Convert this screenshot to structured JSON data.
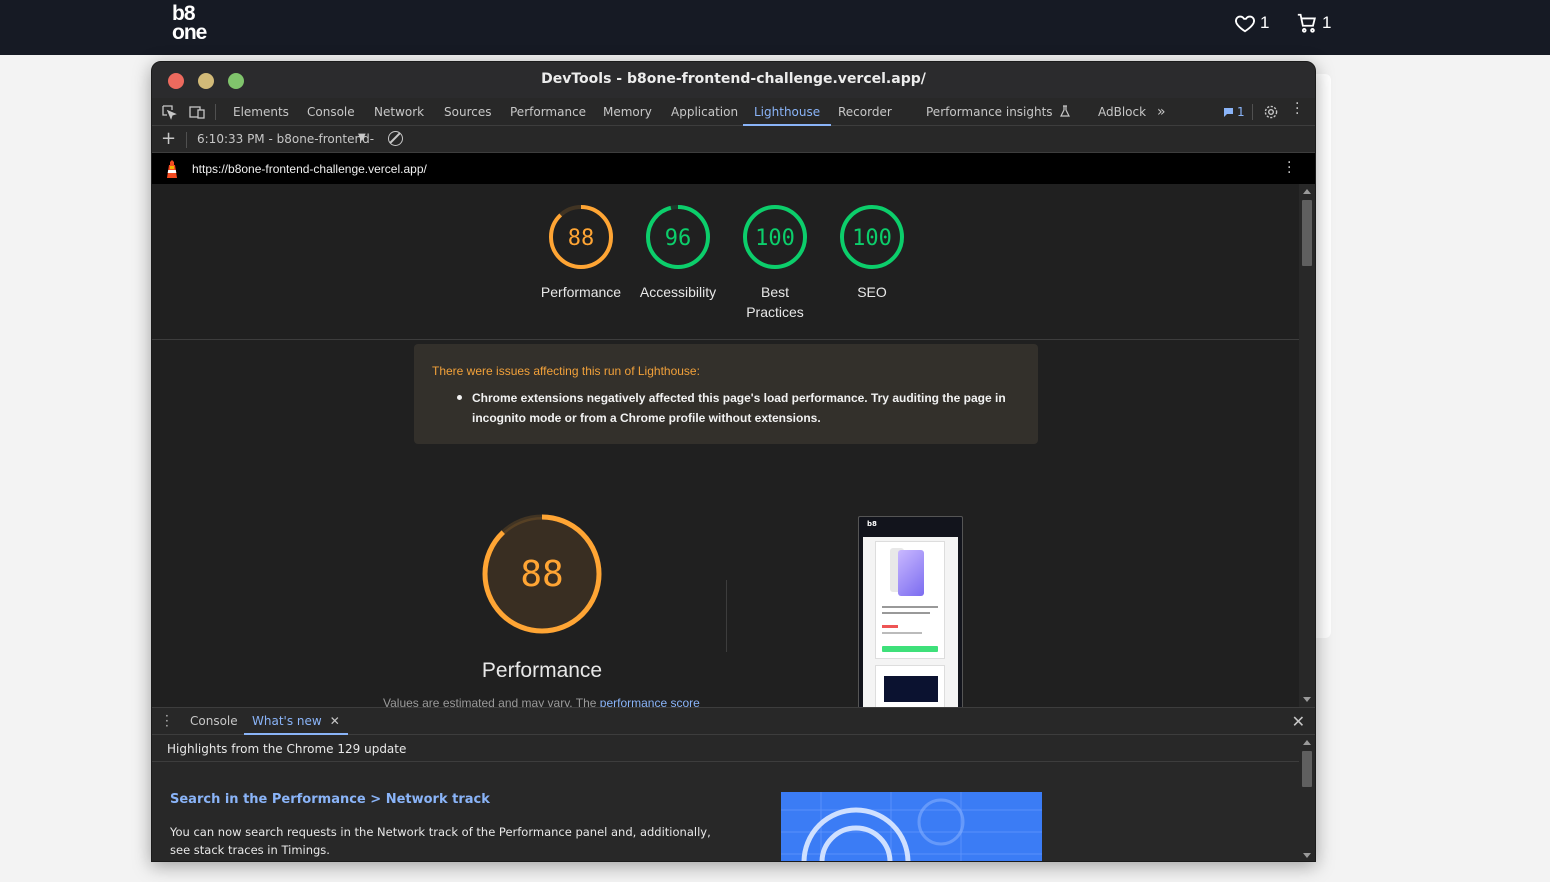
{
  "site": {
    "logo_top": "b8",
    "logo_bottom": "one",
    "wishlist_count": "1",
    "cart_count": "1"
  },
  "window": {
    "title": "DevTools - b8one-frontend-challenge.vercel.app/"
  },
  "tabs": [
    {
      "label": "Elements"
    },
    {
      "label": "Console"
    },
    {
      "label": "Network"
    },
    {
      "label": "Sources"
    },
    {
      "label": "Performance"
    },
    {
      "label": "Memory"
    },
    {
      "label": "Application"
    },
    {
      "label": "Lighthouse",
      "active": true
    },
    {
      "label": "Recorder"
    },
    {
      "label": "Performance insights"
    },
    {
      "label": "AdBlock"
    }
  ],
  "issues_count": "1",
  "lighthouse_toolbar": {
    "report_select": "6:10:33 PM - b8one-frontend-"
  },
  "report": {
    "url": "https://b8one-frontend-challenge.vercel.app/",
    "scores": [
      {
        "label": "Performance",
        "value": "88",
        "color": "#ffa534"
      },
      {
        "label": "Accessibility",
        "value": "96",
        "color": "#0cce6b"
      },
      {
        "label": "Best Practices",
        "value": "100",
        "color": "#0cce6b"
      },
      {
        "label": "SEO",
        "value": "100",
        "color": "#0cce6b"
      }
    ],
    "warning": {
      "title": "There were issues affecting this run of Lighthouse:",
      "items": [
        "Chrome extensions negatively affected this page's load performance. Try auditing the page in incognito mode or from a Chrome profile without extensions."
      ]
    },
    "performance": {
      "score": "88",
      "label": "Performance",
      "note_prefix": "Values are estimated and may vary. The ",
      "note_link": "performance score"
    }
  },
  "drawer": {
    "tabs": [
      {
        "label": "Console"
      },
      {
        "label": "What's new",
        "active": true
      }
    ],
    "subtitle": "Highlights from the Chrome 129 update",
    "feature_title": "Search in the Performance > Network track",
    "feature_text": "You can now search requests in the Network track of the Performance panel and, additionally, see stack traces in Timings."
  },
  "colors": {
    "accent": "#8ab4f8",
    "perf_average": "#ffa534",
    "pass": "#0cce6b",
    "warning_text": "#f2a13a"
  }
}
